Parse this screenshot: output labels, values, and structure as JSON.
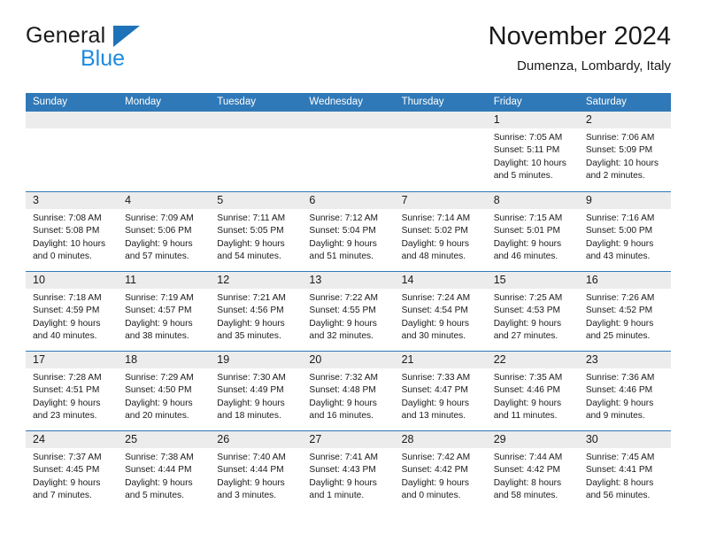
{
  "brand": {
    "line1": "General",
    "line2": "Blue",
    "mark": "triangle-logo",
    "colors": {
      "line1": "#1a1a1a",
      "line2": "#1e8ae0",
      "mark": "#1e72b8"
    }
  },
  "header": {
    "title": "November 2024",
    "subtitle": "Dumenza, Lombardy, Italy"
  },
  "theme": {
    "header_blue": "#3079b8",
    "date_strip_gray": "#ececec",
    "text": "#1a1a1a",
    "background": "#ffffff"
  },
  "weekday_headers": [
    "Sunday",
    "Monday",
    "Tuesday",
    "Wednesday",
    "Thursday",
    "Friday",
    "Saturday"
  ],
  "weeks": [
    [
      {
        "date": "",
        "empty": true,
        "lines": []
      },
      {
        "date": "",
        "empty": true,
        "lines": []
      },
      {
        "date": "",
        "empty": true,
        "lines": []
      },
      {
        "date": "",
        "empty": true,
        "lines": []
      },
      {
        "date": "",
        "empty": true,
        "lines": []
      },
      {
        "date": "1",
        "empty": false,
        "lines": [
          "Sunrise: 7:05 AM",
          "Sunset: 5:11 PM",
          "Daylight: 10 hours",
          "and 5 minutes."
        ]
      },
      {
        "date": "2",
        "empty": false,
        "lines": [
          "Sunrise: 7:06 AM",
          "Sunset: 5:09 PM",
          "Daylight: 10 hours",
          "and 2 minutes."
        ]
      }
    ],
    [
      {
        "date": "3",
        "empty": false,
        "lines": [
          "Sunrise: 7:08 AM",
          "Sunset: 5:08 PM",
          "Daylight: 10 hours",
          "and 0 minutes."
        ]
      },
      {
        "date": "4",
        "empty": false,
        "lines": [
          "Sunrise: 7:09 AM",
          "Sunset: 5:06 PM",
          "Daylight: 9 hours",
          "and 57 minutes."
        ]
      },
      {
        "date": "5",
        "empty": false,
        "lines": [
          "Sunrise: 7:11 AM",
          "Sunset: 5:05 PM",
          "Daylight: 9 hours",
          "and 54 minutes."
        ]
      },
      {
        "date": "6",
        "empty": false,
        "lines": [
          "Sunrise: 7:12 AM",
          "Sunset: 5:04 PM",
          "Daylight: 9 hours",
          "and 51 minutes."
        ]
      },
      {
        "date": "7",
        "empty": false,
        "lines": [
          "Sunrise: 7:14 AM",
          "Sunset: 5:02 PM",
          "Daylight: 9 hours",
          "and 48 minutes."
        ]
      },
      {
        "date": "8",
        "empty": false,
        "lines": [
          "Sunrise: 7:15 AM",
          "Sunset: 5:01 PM",
          "Daylight: 9 hours",
          "and 46 minutes."
        ]
      },
      {
        "date": "9",
        "empty": false,
        "lines": [
          "Sunrise: 7:16 AM",
          "Sunset: 5:00 PM",
          "Daylight: 9 hours",
          "and 43 minutes."
        ]
      }
    ],
    [
      {
        "date": "10",
        "empty": false,
        "lines": [
          "Sunrise: 7:18 AM",
          "Sunset: 4:59 PM",
          "Daylight: 9 hours",
          "and 40 minutes."
        ]
      },
      {
        "date": "11",
        "empty": false,
        "lines": [
          "Sunrise: 7:19 AM",
          "Sunset: 4:57 PM",
          "Daylight: 9 hours",
          "and 38 minutes."
        ]
      },
      {
        "date": "12",
        "empty": false,
        "lines": [
          "Sunrise: 7:21 AM",
          "Sunset: 4:56 PM",
          "Daylight: 9 hours",
          "and 35 minutes."
        ]
      },
      {
        "date": "13",
        "empty": false,
        "lines": [
          "Sunrise: 7:22 AM",
          "Sunset: 4:55 PM",
          "Daylight: 9 hours",
          "and 32 minutes."
        ]
      },
      {
        "date": "14",
        "empty": false,
        "lines": [
          "Sunrise: 7:24 AM",
          "Sunset: 4:54 PM",
          "Daylight: 9 hours",
          "and 30 minutes."
        ]
      },
      {
        "date": "15",
        "empty": false,
        "lines": [
          "Sunrise: 7:25 AM",
          "Sunset: 4:53 PM",
          "Daylight: 9 hours",
          "and 27 minutes."
        ]
      },
      {
        "date": "16",
        "empty": false,
        "lines": [
          "Sunrise: 7:26 AM",
          "Sunset: 4:52 PM",
          "Daylight: 9 hours",
          "and 25 minutes."
        ]
      }
    ],
    [
      {
        "date": "17",
        "empty": false,
        "lines": [
          "Sunrise: 7:28 AM",
          "Sunset: 4:51 PM",
          "Daylight: 9 hours",
          "and 23 minutes."
        ]
      },
      {
        "date": "18",
        "empty": false,
        "lines": [
          "Sunrise: 7:29 AM",
          "Sunset: 4:50 PM",
          "Daylight: 9 hours",
          "and 20 minutes."
        ]
      },
      {
        "date": "19",
        "empty": false,
        "lines": [
          "Sunrise: 7:30 AM",
          "Sunset: 4:49 PM",
          "Daylight: 9 hours",
          "and 18 minutes."
        ]
      },
      {
        "date": "20",
        "empty": false,
        "lines": [
          "Sunrise: 7:32 AM",
          "Sunset: 4:48 PM",
          "Daylight: 9 hours",
          "and 16 minutes."
        ]
      },
      {
        "date": "21",
        "empty": false,
        "lines": [
          "Sunrise: 7:33 AM",
          "Sunset: 4:47 PM",
          "Daylight: 9 hours",
          "and 13 minutes."
        ]
      },
      {
        "date": "22",
        "empty": false,
        "lines": [
          "Sunrise: 7:35 AM",
          "Sunset: 4:46 PM",
          "Daylight: 9 hours",
          "and 11 minutes."
        ]
      },
      {
        "date": "23",
        "empty": false,
        "lines": [
          "Sunrise: 7:36 AM",
          "Sunset: 4:46 PM",
          "Daylight: 9 hours",
          "and 9 minutes."
        ]
      }
    ],
    [
      {
        "date": "24",
        "empty": false,
        "lines": [
          "Sunrise: 7:37 AM",
          "Sunset: 4:45 PM",
          "Daylight: 9 hours",
          "and 7 minutes."
        ]
      },
      {
        "date": "25",
        "empty": false,
        "lines": [
          "Sunrise: 7:38 AM",
          "Sunset: 4:44 PM",
          "Daylight: 9 hours",
          "and 5 minutes."
        ]
      },
      {
        "date": "26",
        "empty": false,
        "lines": [
          "Sunrise: 7:40 AM",
          "Sunset: 4:44 PM",
          "Daylight: 9 hours",
          "and 3 minutes."
        ]
      },
      {
        "date": "27",
        "empty": false,
        "lines": [
          "Sunrise: 7:41 AM",
          "Sunset: 4:43 PM",
          "Daylight: 9 hours",
          "and 1 minute."
        ]
      },
      {
        "date": "28",
        "empty": false,
        "lines": [
          "Sunrise: 7:42 AM",
          "Sunset: 4:42 PM",
          "Daylight: 9 hours",
          "and 0 minutes."
        ]
      },
      {
        "date": "29",
        "empty": false,
        "lines": [
          "Sunrise: 7:44 AM",
          "Sunset: 4:42 PM",
          "Daylight: 8 hours",
          "and 58 minutes."
        ]
      },
      {
        "date": "30",
        "empty": false,
        "lines": [
          "Sunrise: 7:45 AM",
          "Sunset: 4:41 PM",
          "Daylight: 8 hours",
          "and 56 minutes."
        ]
      }
    ]
  ]
}
